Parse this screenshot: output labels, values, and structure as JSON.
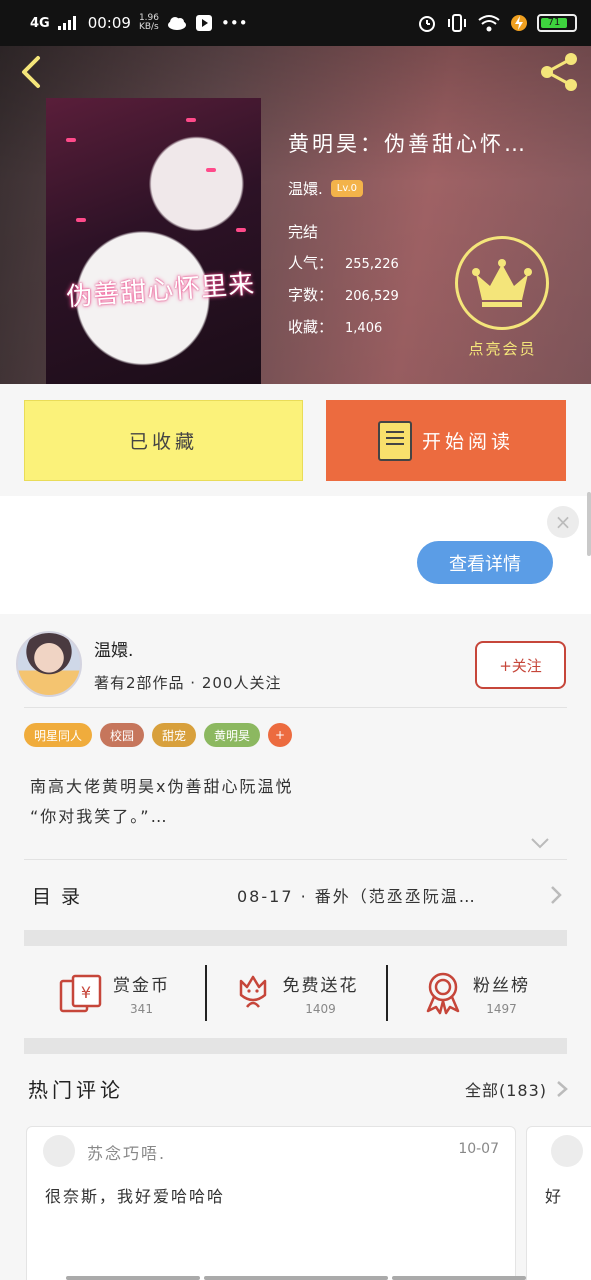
{
  "status_bar": {
    "network": "4G",
    "time": "00:09",
    "speed_value": "1.96",
    "speed_unit": "KB/s",
    "battery": "71"
  },
  "book": {
    "title": "黄明昊：伪善甜心怀…",
    "cover_text": "伪善甜心怀里来",
    "author": "温嬛.",
    "author_level": "Lv.0",
    "status": "完结",
    "popularity_label": "人气：",
    "popularity": "255,226",
    "words_label": "字数：",
    "words": "206,529",
    "favorites_label": "收藏：",
    "favorites": "1,406"
  },
  "vip": {
    "label": "点亮会员"
  },
  "actions": {
    "collected_label": "已收藏",
    "read_label": "开始阅读"
  },
  "ad": {
    "close": "×",
    "detail_label": "查看详情"
  },
  "author": {
    "name": "温嬛.",
    "stats": "著有2部作品 · 200人关注",
    "follow_label": "+关注"
  },
  "tags": [
    {
      "label": "明星同人",
      "color": "#f0ac3c"
    },
    {
      "label": "校园",
      "color": "#c6765c"
    },
    {
      "label": "甜宠",
      "color": "#d8a03c"
    },
    {
      "label": "黄明昊",
      "color": "#8cb860"
    },
    {
      "label": "+",
      "color": "#ec6b3f"
    }
  ],
  "synopsis": {
    "line1": "南高大佬黄明昊x伪善甜心阮温悦",
    "line2": "“你对我笑了。”…"
  },
  "toc": {
    "label": "目录",
    "latest": "08-17 · 番外（范丞丞阮温…"
  },
  "gifts": [
    {
      "name": "赏金币",
      "count": "341",
      "icon": "red-envelope-icon"
    },
    {
      "name": "免费送花",
      "count": "1409",
      "icon": "flower-icon"
    },
    {
      "name": "粉丝榜",
      "count": "1497",
      "icon": "medal-icon"
    }
  ],
  "comments": {
    "title": "热门评论",
    "all_label": "全部(183)",
    "items": [
      {
        "user": "苏念巧唔.",
        "date": "10-07",
        "text": "很奈斯，我好爱哈哈哈"
      },
      {
        "user": "",
        "date": "",
        "text": "好"
      }
    ]
  },
  "colors": {
    "accent_orange": "#ec6b3f",
    "collected_yellow": "#fbf27a",
    "vip_gold": "#f4e57a",
    "follow_red": "#c6463a",
    "ad_blue": "#5b9de6"
  }
}
